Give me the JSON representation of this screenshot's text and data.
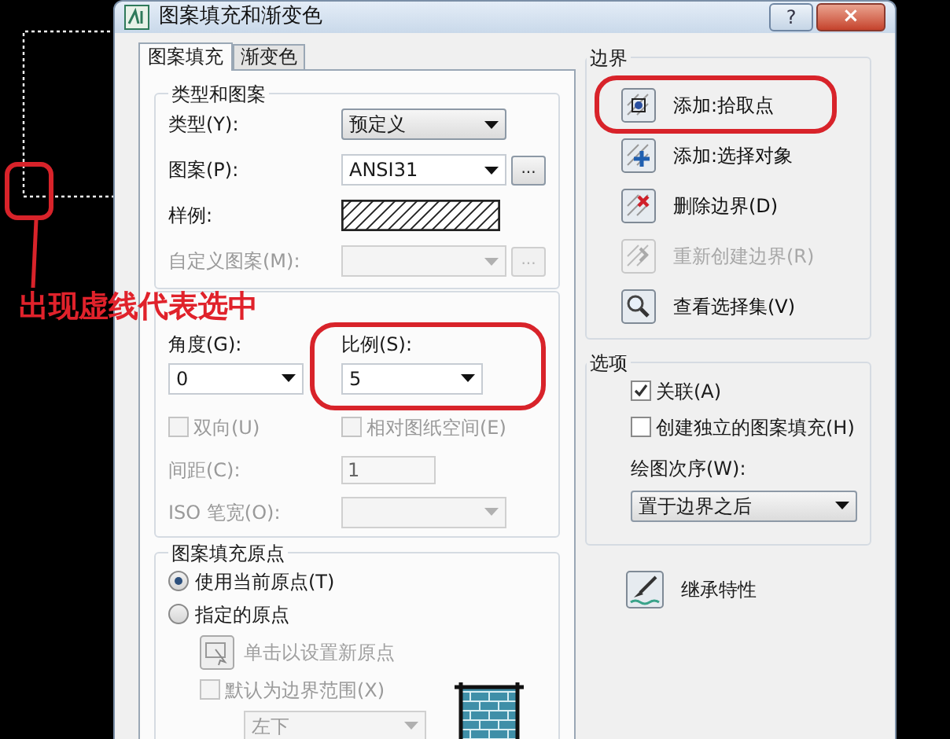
{
  "window": {
    "title": "图案填充和渐变色",
    "help": "?",
    "close": "×"
  },
  "tabs": [
    {
      "label": "图案填充",
      "selected": true
    },
    {
      "label": "渐变色",
      "selected": false
    }
  ],
  "type_and_pattern": {
    "title": "类型和图案",
    "rows": [
      {
        "kind": "combo",
        "label": "类型(Y):",
        "value": "预定义",
        "disabled": false
      },
      {
        "kind": "combo_browse",
        "label": "图案(P):",
        "value": "ANSI31",
        "browse": "...",
        "disabled": false
      },
      {
        "kind": "swatch",
        "label": "样例:",
        "disabled": false
      },
      {
        "kind": "combo_browse",
        "label": "自定义图案(M):",
        "browse": "...",
        "disabled": true
      }
    ]
  },
  "angle_scale": {
    "angle": {
      "label": "角度(G):",
      "value": "0"
    },
    "scale": {
      "label": "比例(S):",
      "value": "5"
    },
    "checks": [
      {
        "label": "双向(U)",
        "checked": false,
        "disabled": true
      },
      {
        "label": "相对图纸空间(E)",
        "checked": false,
        "disabled": true
      }
    ],
    "spacing": {
      "label": "间距(C):",
      "value": "1",
      "disabled": true
    },
    "iso_pen": {
      "label": "ISO 笔宽(O):",
      "disabled": true
    }
  },
  "origin": {
    "title": "图案填充原点",
    "options": [
      {
        "label": "使用当前原点(T)",
        "selected": true
      },
      {
        "label": "指定的原点",
        "selected": false
      }
    ],
    "set_origin": {
      "label": "单击以设置新原点",
      "disabled": true
    },
    "default_extent": {
      "label": "默认为边界范围(X)",
      "checked": false,
      "disabled": true
    },
    "position": {
      "value": "左下",
      "disabled": true
    }
  },
  "boundaries": {
    "title": "边界",
    "actions": [
      {
        "kind": "pick",
        "label": "添加:拾取点",
        "disabled": false
      },
      {
        "kind": "select",
        "label": "添加:选择对象",
        "disabled": false
      },
      {
        "kind": "remove",
        "label": "删除边界(D)",
        "disabled": false
      },
      {
        "kind": "recreate",
        "label": "重新创建边界(R)",
        "disabled": true
      },
      {
        "kind": "view",
        "label": "查看选择集(V)",
        "disabled": false
      }
    ]
  },
  "options": {
    "title": "选项",
    "checks": [
      {
        "label": "关联(A)",
        "checked": true
      },
      {
        "label": "创建独立的图案填充(H)",
        "checked": false
      }
    ],
    "draw_order": {
      "label": "绘图次序(W):",
      "value": "置于边界之后"
    }
  },
  "inherit": {
    "label": "继承特性"
  },
  "annotation": {
    "text": "出现虚线代表选中"
  }
}
